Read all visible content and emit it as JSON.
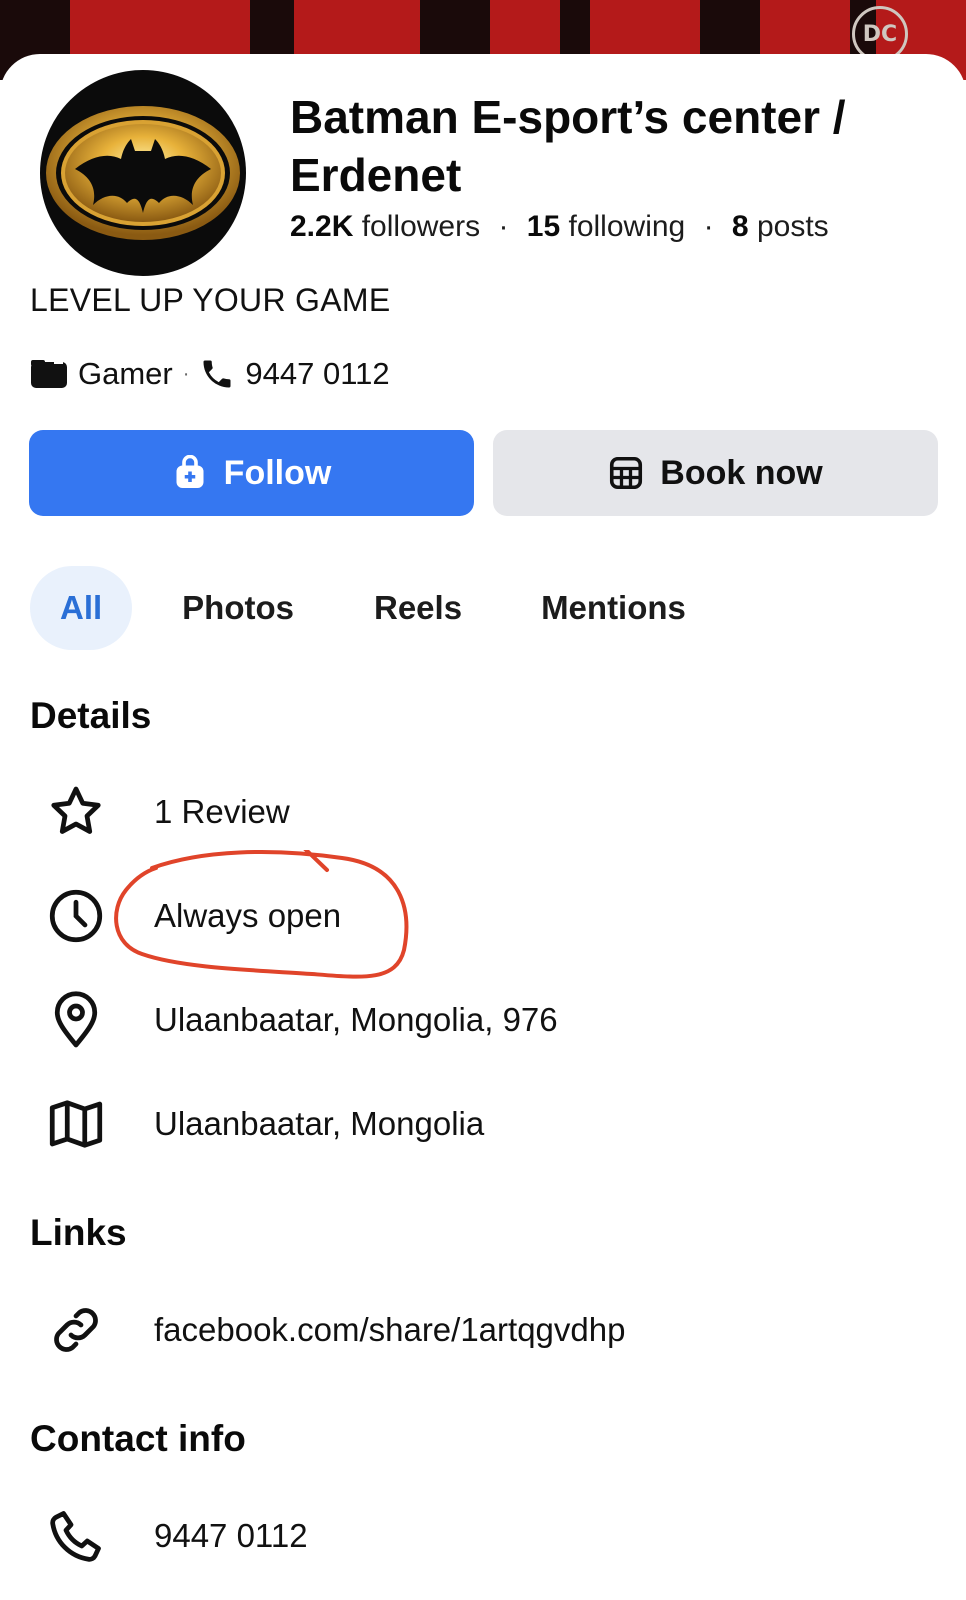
{
  "cover": {
    "logo_text": "DC",
    "color": "#b41a1a"
  },
  "profile": {
    "name": "Batman E-sport’s center / Erdenet",
    "stats": {
      "followers_count": "2.2K",
      "followers_label": "followers",
      "following_count": "15",
      "following_label": "following",
      "posts_count": "8",
      "posts_label": "posts",
      "separator": "·"
    },
    "bio": "LEVEL UP YOUR GAME",
    "category": "Gamer",
    "meta_separator": "·",
    "phone": "9447 0112"
  },
  "actions": {
    "follow_label": "Follow",
    "book_label": "Book now",
    "follow_color": "#3577f1"
  },
  "tabs": [
    {
      "label": "All",
      "active": true
    },
    {
      "label": "Photos",
      "active": false
    },
    {
      "label": "Reels",
      "active": false
    },
    {
      "label": "Mentions",
      "active": false
    }
  ],
  "details": {
    "title": "Details",
    "items": [
      {
        "icon": "star-icon",
        "text": "1 Review"
      },
      {
        "icon": "clock-icon",
        "text": "Always open"
      },
      {
        "icon": "location-pin-icon",
        "text": "Ulaanbaatar, Mongolia, 976"
      },
      {
        "icon": "map-icon",
        "text": "Ulaanbaatar, Mongolia"
      }
    ]
  },
  "links": {
    "title": "Links",
    "items": [
      {
        "icon": "link-icon",
        "text": "facebook.com/share/1artqgvdhp"
      }
    ]
  },
  "contact": {
    "title": "Contact info",
    "items": [
      {
        "icon": "phone-icon",
        "text": "9447 0112"
      }
    ]
  },
  "annotation": {
    "color": "#e0442a"
  }
}
